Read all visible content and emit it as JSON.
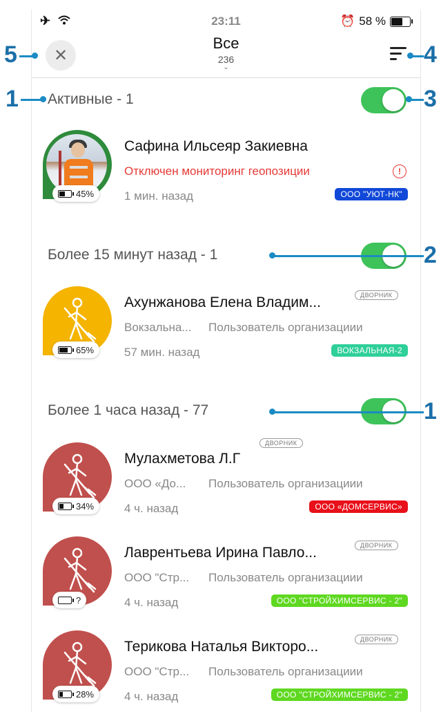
{
  "status_bar": {
    "time": "23:11",
    "battery": "58 %"
  },
  "header": {
    "title": "Все",
    "count": "236",
    "chevron": "⌄"
  },
  "sections": [
    {
      "label": "Активные  -  1"
    },
    {
      "label": "Более 15 минут назад  -  1"
    },
    {
      "label": "Более 1 часа назад  -  77"
    }
  ],
  "items": [
    {
      "name": "Сафина Ильсеяр Закиевна",
      "alert": "Отключен мониторинг геопозиции",
      "time": "1 мин. назад",
      "tag": "ООО \"УЮТ-НК\"",
      "tag_color": "#1148d8",
      "battery": "45%",
      "avatar_color": "#2e8b3c"
    },
    {
      "name": "Ахунжанова Елена Владим...",
      "role": "ДВОРНИК",
      "org": "Вокзальна...",
      "user_type": "Пользователь организациии",
      "time": "57 мин. назад",
      "tag": "ВОКЗАЛЬНАЯ-2",
      "tag_color": "#2fcf9a",
      "battery": "65%",
      "avatar_color": "#f4b400"
    },
    {
      "name": "Мулахметова Л.Г",
      "role": "ДВОРНИК",
      "org": "ООО «До...",
      "user_type": "Пользователь организациии",
      "time": "4 ч. назад",
      "tag": "ООО «ДОМСЕРВИС»",
      "tag_color": "#e8101a",
      "battery": "34%",
      "avatar_color": "#c0504d"
    },
    {
      "name": "Лаврентьева Ирина Павло...",
      "role": "ДВОРНИК",
      "org": "ООО \"Стр...",
      "user_type": "Пользователь организациии",
      "time": "4 ч. назад",
      "tag": "ООО \"СТРОЙХИМСЕРВИС - 2\"",
      "tag_color": "#5ed820",
      "battery": "?",
      "avatar_color": "#c0504d"
    },
    {
      "name": "Терикова Наталья Викторо...",
      "role": "ДВОРНИК",
      "org": "ООО \"Стр...",
      "user_type": "Пользователь организациии",
      "time": "4 ч. назад",
      "tag": "ООО \"СТРОЙХИМСЕРВИС - 2\"",
      "tag_color": "#5ed820",
      "battery": "28%",
      "avatar_color": "#c0504d"
    }
  ],
  "annotations": {
    "a1": "1",
    "a2": "2",
    "a3": "3",
    "a4": "4",
    "a5": "5",
    "a6": "1"
  }
}
